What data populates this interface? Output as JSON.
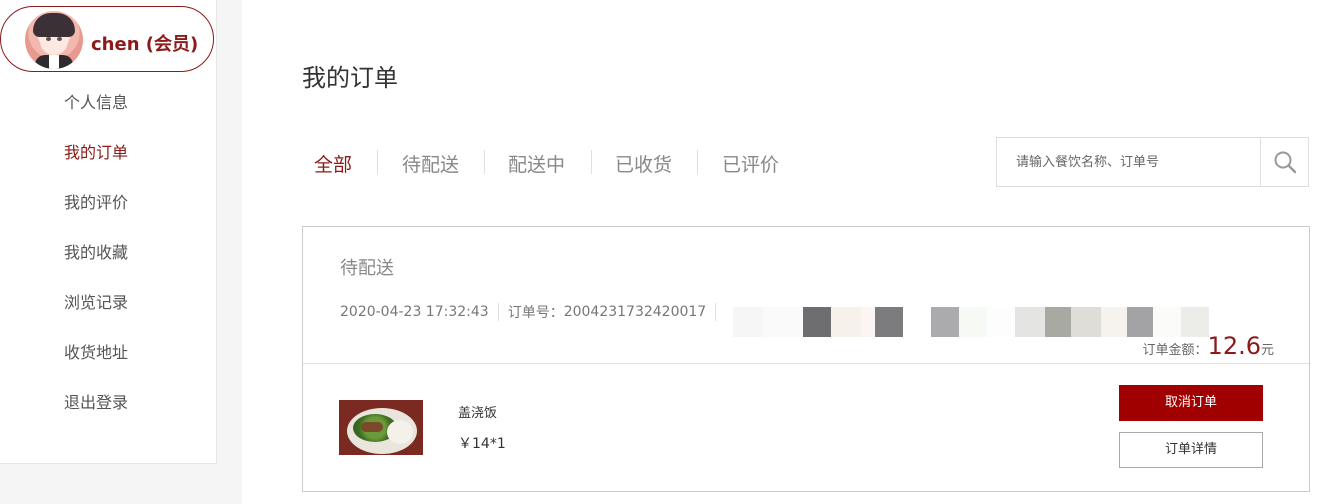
{
  "user": {
    "name": "chen (会员)"
  },
  "sidebar": {
    "items": [
      {
        "label": "个人信息",
        "active": false
      },
      {
        "label": "我的订单",
        "active": true
      },
      {
        "label": "我的评价",
        "active": false
      },
      {
        "label": "我的收藏",
        "active": false
      },
      {
        "label": "浏览记录",
        "active": false
      },
      {
        "label": "收货地址",
        "active": false
      },
      {
        "label": "退出登录",
        "active": false
      }
    ]
  },
  "main": {
    "title": "我的订单",
    "tabs": [
      {
        "label": "全部",
        "active": true
      },
      {
        "label": "待配送",
        "active": false
      },
      {
        "label": "配送中",
        "active": false
      },
      {
        "label": "已收货",
        "active": false
      },
      {
        "label": "已评价",
        "active": false
      }
    ],
    "search": {
      "placeholder": "请输入餐饮名称、订单号",
      "value": "",
      "icon": "search-icon"
    }
  },
  "order": {
    "status": "待配送",
    "datetime": "2020-04-23 17:32:43",
    "order_no_label": "订单号：",
    "order_no": "2004231732420017",
    "amount_label": "订单金额：",
    "amount": "12.6",
    "amount_unit": "元",
    "item": {
      "name": "盖浇饭",
      "price": "￥14*1"
    },
    "actions": {
      "cancel": "取消订单",
      "detail": "订单详情"
    }
  },
  "colors": {
    "accent": "#8b1a1a",
    "button": "#a10000"
  }
}
